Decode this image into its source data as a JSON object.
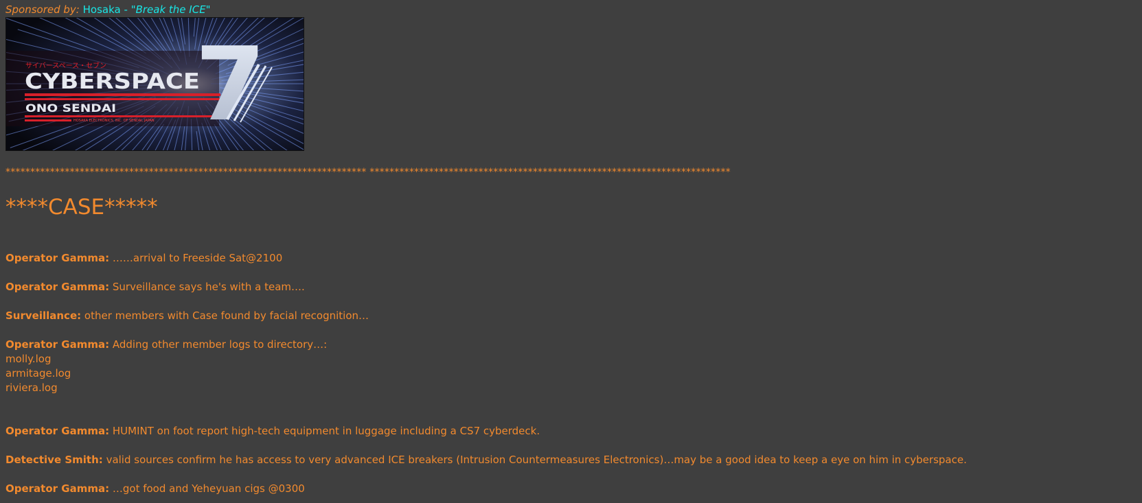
{
  "sponsor": {
    "lead": "Sponsored by:",
    "brand": "Hosaka -",
    "tagline": "\"Break the ICE\""
  },
  "banner": {
    "japanese": "サイバースペース・セブン",
    "title": "CYBERSPACE",
    "numeral": "7",
    "maker": "ONO SENDAI",
    "fineprint": "HOSAKA ELECTRONICS, INC. OF SENDAI, JAPAN"
  },
  "separator": "************************************************************************* *************************************************************************",
  "heading": "****CASE*****",
  "entries": [
    {
      "speaker": "Operator Gamma:",
      "text": "……arrival to Freeside Sat@2100"
    },
    {
      "speaker": "Operator Gamma:",
      "text": "Surveillance says he's with a team…."
    },
    {
      "speaker": "Surveillance:",
      "text": "other members with Case found by facial recognition…"
    },
    {
      "speaker": "Operator Gamma:",
      "text": "Adding other member logs to directory…:"
    },
    {
      "speaker": "Operator Gamma:",
      "text": "HUMINT on foot report high-tech equipment in luggage including a CS7 cyberdeck."
    },
    {
      "speaker": "Detective Smith:",
      "text": "valid sources confirm he has access to very advanced ICE breakers (Intrusion Countermeasures Electronics)…may be a good idea to keep a eye on him in cyberspace."
    },
    {
      "speaker": "Operator Gamma:",
      "text": "…got food and Yeheyuan cigs @0300"
    }
  ],
  "logs": [
    "molly.log",
    "armitage.log",
    "riviera.log"
  ],
  "colors": {
    "background": "#3f3f3f",
    "text": "#f28a2e",
    "link": "#19e6e6"
  }
}
